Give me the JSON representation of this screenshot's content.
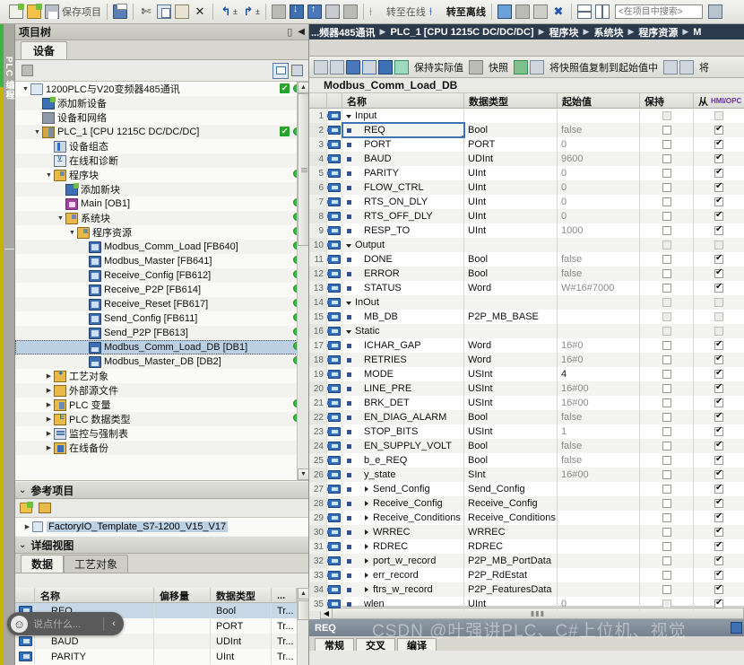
{
  "toolbar": {
    "save_label": "保存项目",
    "online_label": "转至在线",
    "offline_label": "转至离线",
    "search_placeholder": "<在项目中搜索>"
  },
  "project_tree": {
    "title": "项目树",
    "tab": "设备",
    "items": [
      {
        "indent": 0,
        "arrow": "▼",
        "icon": "i-proj",
        "label": "1200PLC与V20变频器485通讯",
        "check": true,
        "dot": true
      },
      {
        "indent": 1,
        "arrow": "",
        "icon": "i-newdev",
        "label": "添加新设备",
        "check": false,
        "dot": false
      },
      {
        "indent": 1,
        "arrow": "",
        "icon": "i-net",
        "label": "设备和网络",
        "check": false,
        "dot": false
      },
      {
        "indent": 1,
        "arrow": "▼",
        "icon": "i-plc",
        "label": "PLC_1 [CPU 1215C DC/DC/DC]",
        "check": true,
        "dot": true
      },
      {
        "indent": 2,
        "arrow": "",
        "icon": "i-devcfg",
        "label": "设备组态",
        "check": false,
        "dot": false
      },
      {
        "indent": 2,
        "arrow": "",
        "icon": "i-diag",
        "label": "在线和诊断",
        "check": false,
        "dot": false
      },
      {
        "indent": 2,
        "arrow": "▼",
        "icon": "i-folder",
        "label": "程序块",
        "check": false,
        "dot": true
      },
      {
        "indent": 3,
        "arrow": "",
        "icon": "i-newdev",
        "label": "添加新块",
        "check": false,
        "dot": false
      },
      {
        "indent": 3,
        "arrow": "",
        "icon": "i-ob",
        "label": "Main [OB1]",
        "check": false,
        "dot": true
      },
      {
        "indent": 3,
        "arrow": "▼",
        "icon": "i-folder",
        "label": "系统块",
        "check": false,
        "dot": true
      },
      {
        "indent": 4,
        "arrow": "▼",
        "icon": "i-folder",
        "label": "程序资源",
        "check": false,
        "dot": true
      },
      {
        "indent": 5,
        "arrow": "",
        "icon": "i-fb",
        "label": "Modbus_Comm_Load [FB640]",
        "check": false,
        "dot": true
      },
      {
        "indent": 5,
        "arrow": "",
        "icon": "i-fb",
        "label": "Modbus_Master [FB641]",
        "check": false,
        "dot": true
      },
      {
        "indent": 5,
        "arrow": "",
        "icon": "i-fb",
        "label": "Receive_Config [FB612]",
        "check": false,
        "dot": true
      },
      {
        "indent": 5,
        "arrow": "",
        "icon": "i-fb",
        "label": "Receive_P2P [FB614]",
        "check": false,
        "dot": true
      },
      {
        "indent": 5,
        "arrow": "",
        "icon": "i-fb",
        "label": "Receive_Reset [FB617]",
        "check": false,
        "dot": true
      },
      {
        "indent": 5,
        "arrow": "",
        "icon": "i-fb",
        "label": "Send_Config [FB611]",
        "check": false,
        "dot": true
      },
      {
        "indent": 5,
        "arrow": "",
        "icon": "i-fb",
        "label": "Send_P2P [FB613]",
        "check": false,
        "dot": true
      },
      {
        "indent": 5,
        "arrow": "",
        "icon": "i-db",
        "label": "Modbus_Comm_Load_DB [DB1]",
        "check": false,
        "dot": true,
        "selected": true
      },
      {
        "indent": 5,
        "arrow": "",
        "icon": "i-db",
        "label": "Modbus_Master_DB [DB2]",
        "check": false,
        "dot": true
      },
      {
        "indent": 2,
        "arrow": "▶",
        "icon": "i-tech",
        "label": "工艺对象",
        "check": false,
        "dot": false
      },
      {
        "indent": 2,
        "arrow": "▶",
        "icon": "i-ext",
        "label": "外部源文件",
        "check": false,
        "dot": false
      },
      {
        "indent": 2,
        "arrow": "▶",
        "icon": "i-var",
        "label": "PLC 变量",
        "check": false,
        "dot": true
      },
      {
        "indent": 2,
        "arrow": "▶",
        "icon": "i-dtype",
        "label": "PLC 数据类型",
        "check": false,
        "dot": true
      },
      {
        "indent": 2,
        "arrow": "▶",
        "icon": "i-watch",
        "label": "监控与强制表",
        "check": false,
        "dot": false
      },
      {
        "indent": 2,
        "arrow": "▶",
        "icon": "i-backup",
        "label": "在线备份",
        "check": false,
        "dot": false
      }
    ]
  },
  "reference_projects": {
    "title": "参考项目",
    "item": "FactoryIO_Template_S7-1200_V15_V17"
  },
  "detail_view": {
    "title": "详细视图",
    "tabs": [
      "数据",
      "工艺对象"
    ],
    "active_tab": "数据",
    "headers": [
      "名称",
      "偏移量",
      "数据类型",
      "..."
    ],
    "rows": [
      {
        "name": "REQ",
        "offset": "",
        "type": "Bool",
        "more": "Tr...",
        "selected": true
      },
      {
        "name": "PORT",
        "offset": "",
        "type": "PORT",
        "more": "Tr..."
      },
      {
        "name": "BAUD",
        "offset": "",
        "type": "UDInt",
        "more": "Tr..."
      },
      {
        "name": "PARITY",
        "offset": "",
        "type": "UInt",
        "more": "Tr..."
      }
    ]
  },
  "vertical_tab": {
    "label": "PLC 编程"
  },
  "editor": {
    "breadcrumb": [
      "...频器485通讯",
      "PLC_1 [CPU 1215C DC/DC/DC]",
      "程序块",
      "系统块",
      "程序资源",
      "M"
    ],
    "toolbar": {
      "keep_actual_label": "保持实际值",
      "snapshot_label": "快照",
      "copy_snapshot_label": "将快照值复制到起始值中"
    },
    "block_title": "Modbus_Comm_Load_DB",
    "table_headers": {
      "name": "名称",
      "datatype": "数据类型",
      "startvalue": "起始值",
      "retain": "保持",
      "hmi": "从",
      "hmi_sub": "HMI/OPC"
    },
    "rows": [
      {
        "n": "1",
        "ind": "▼",
        "level": 0,
        "name": "Input",
        "type": "",
        "start": "",
        "retain": "dis",
        "hmi": "dis"
      },
      {
        "n": "2",
        "ind": "■",
        "level": 1,
        "name": "REQ",
        "type": "Bool",
        "start": "false",
        "retain": "off",
        "hmi": "on",
        "selected": true
      },
      {
        "n": "3",
        "ind": "■",
        "level": 1,
        "name": "PORT",
        "type": "PORT",
        "start": "0",
        "retain": "off",
        "hmi": "on"
      },
      {
        "n": "4",
        "ind": "■",
        "level": 1,
        "name": "BAUD",
        "type": "UDInt",
        "start": "9600",
        "retain": "off",
        "hmi": "on"
      },
      {
        "n": "5",
        "ind": "■",
        "level": 1,
        "name": "PARITY",
        "type": "UInt",
        "start": "0",
        "retain": "off",
        "hmi": "on"
      },
      {
        "n": "6",
        "ind": "■",
        "level": 1,
        "name": "FLOW_CTRL",
        "type": "UInt",
        "start": "0",
        "retain": "off",
        "hmi": "on"
      },
      {
        "n": "7",
        "ind": "■",
        "level": 1,
        "name": "RTS_ON_DLY",
        "type": "UInt",
        "start": "0",
        "retain": "off",
        "hmi": "on"
      },
      {
        "n": "8",
        "ind": "■",
        "level": 1,
        "name": "RTS_OFF_DLY",
        "type": "UInt",
        "start": "0",
        "retain": "off",
        "hmi": "on"
      },
      {
        "n": "9",
        "ind": "■",
        "level": 1,
        "name": "RESP_TO",
        "type": "UInt",
        "start": "1000",
        "retain": "off",
        "hmi": "on"
      },
      {
        "n": "10",
        "ind": "▼",
        "level": 0,
        "name": "Output",
        "type": "",
        "start": "",
        "retain": "dis",
        "hmi": "dis"
      },
      {
        "n": "11",
        "ind": "■",
        "level": 1,
        "name": "DONE",
        "type": "Bool",
        "start": "false",
        "retain": "off",
        "hmi": "on"
      },
      {
        "n": "12",
        "ind": "■",
        "level": 1,
        "name": "ERROR",
        "type": "Bool",
        "start": "false",
        "retain": "off",
        "hmi": "on"
      },
      {
        "n": "13",
        "ind": "■",
        "level": 1,
        "name": "STATUS",
        "type": "Word",
        "start": "W#16#7000",
        "retain": "off",
        "hmi": "on"
      },
      {
        "n": "14",
        "ind": "▼",
        "level": 0,
        "name": "InOut",
        "type": "",
        "start": "",
        "retain": "dis",
        "hmi": "dis"
      },
      {
        "n": "15",
        "ind": "■",
        "level": 1,
        "name": "MB_DB",
        "type": "P2P_MB_BASE",
        "start": "",
        "retain": "dis",
        "hmi": "dis"
      },
      {
        "n": "16",
        "ind": "▼",
        "level": 0,
        "name": "Static",
        "type": "",
        "start": "",
        "retain": "dis",
        "hmi": "dis"
      },
      {
        "n": "17",
        "ind": "■",
        "level": 1,
        "name": "ICHAR_GAP",
        "type": "Word",
        "start": "16#0",
        "retain": "off",
        "hmi": "on"
      },
      {
        "n": "18",
        "ind": "■",
        "level": 1,
        "name": "RETRIES",
        "type": "Word",
        "start": "16#0",
        "retain": "off",
        "hmi": "on"
      },
      {
        "n": "19",
        "ind": "■",
        "level": 1,
        "name": "MODE",
        "type": "USInt",
        "start": "4",
        "retain": "off",
        "hmi": "on",
        "start_dark": true
      },
      {
        "n": "20",
        "ind": "■",
        "level": 1,
        "name": "LINE_PRE",
        "type": "USInt",
        "start": "16#00",
        "retain": "off",
        "hmi": "on"
      },
      {
        "n": "21",
        "ind": "■",
        "level": 1,
        "name": "BRK_DET",
        "type": "USInt",
        "start": "16#00",
        "retain": "off",
        "hmi": "on"
      },
      {
        "n": "22",
        "ind": "■",
        "level": 1,
        "name": "EN_DIAG_ALARM",
        "type": "Bool",
        "start": "false",
        "retain": "off",
        "hmi": "on"
      },
      {
        "n": "23",
        "ind": "■",
        "level": 1,
        "name": "STOP_BITS",
        "type": "USInt",
        "start": "1",
        "retain": "off",
        "hmi": "on"
      },
      {
        "n": "24",
        "ind": "■",
        "level": 1,
        "name": "EN_SUPPLY_VOLT",
        "type": "Bool",
        "start": "false",
        "retain": "off",
        "hmi": "on"
      },
      {
        "n": "25",
        "ind": "■",
        "level": 1,
        "name": "b_e_REQ",
        "type": "Bool",
        "start": "false",
        "retain": "off",
        "hmi": "on"
      },
      {
        "n": "26",
        "ind": "■",
        "level": 1,
        "name": "y_state",
        "type": "SInt",
        "start": "16#00",
        "retain": "off",
        "hmi": "on"
      },
      {
        "n": "27",
        "ind": "■",
        "level": 1,
        "expand": "▶",
        "name": "Send_Config",
        "type": "Send_Config",
        "start": "",
        "retain": "off",
        "hmi": "on"
      },
      {
        "n": "28",
        "ind": "■",
        "level": 1,
        "expand": "▶",
        "name": "Receive_Config",
        "type": "Receive_Config",
        "start": "",
        "retain": "off",
        "hmi": "on"
      },
      {
        "n": "29",
        "ind": "■",
        "level": 1,
        "expand": "▶",
        "name": "Receive_Conditions",
        "type": "Receive_Conditions",
        "start": "",
        "retain": "off",
        "hmi": "on"
      },
      {
        "n": "30",
        "ind": "■",
        "level": 1,
        "expand": "▶",
        "name": "WRREC",
        "type": "WRREC",
        "start": "",
        "retain": "off",
        "hmi": "on"
      },
      {
        "n": "31",
        "ind": "■",
        "level": 1,
        "expand": "▶",
        "name": "RDREC",
        "type": "RDREC",
        "start": "",
        "retain": "off",
        "hmi": "on"
      },
      {
        "n": "32",
        "ind": "■",
        "level": 1,
        "expand": "▶",
        "name": "port_w_record",
        "type": "P2P_MB_PortData",
        "start": "",
        "retain": "off",
        "hmi": "on"
      },
      {
        "n": "33",
        "ind": "■",
        "level": 1,
        "expand": "▶",
        "name": "err_record",
        "type": "P2P_RdEstat",
        "start": "",
        "retain": "off",
        "hmi": "on"
      },
      {
        "n": "34",
        "ind": "■",
        "level": 1,
        "expand": "▶",
        "name": "ftrs_w_record",
        "type": "P2P_FeaturesData",
        "start": "",
        "retain": "off",
        "hmi": "on"
      },
      {
        "n": "35",
        "ind": "■",
        "level": 1,
        "name": "wlen",
        "type": "UInt",
        "start": "0",
        "retain": "dis",
        "hmi": "on"
      }
    ]
  },
  "status_bar": {
    "label": "REQ",
    "watermark": "CSDN @叶强讲PLC、C#上位机、视觉"
  },
  "bottom_tabs": [
    "常规",
    "交叉",
    "编译"
  ],
  "colors": {
    "accent_blue": "#3f72b5",
    "breadcrumb_bg": "#2b3a4d",
    "status_green": "#3eb53e",
    "check_green": "#27a22b",
    "highlight": "#bcd0e4"
  }
}
